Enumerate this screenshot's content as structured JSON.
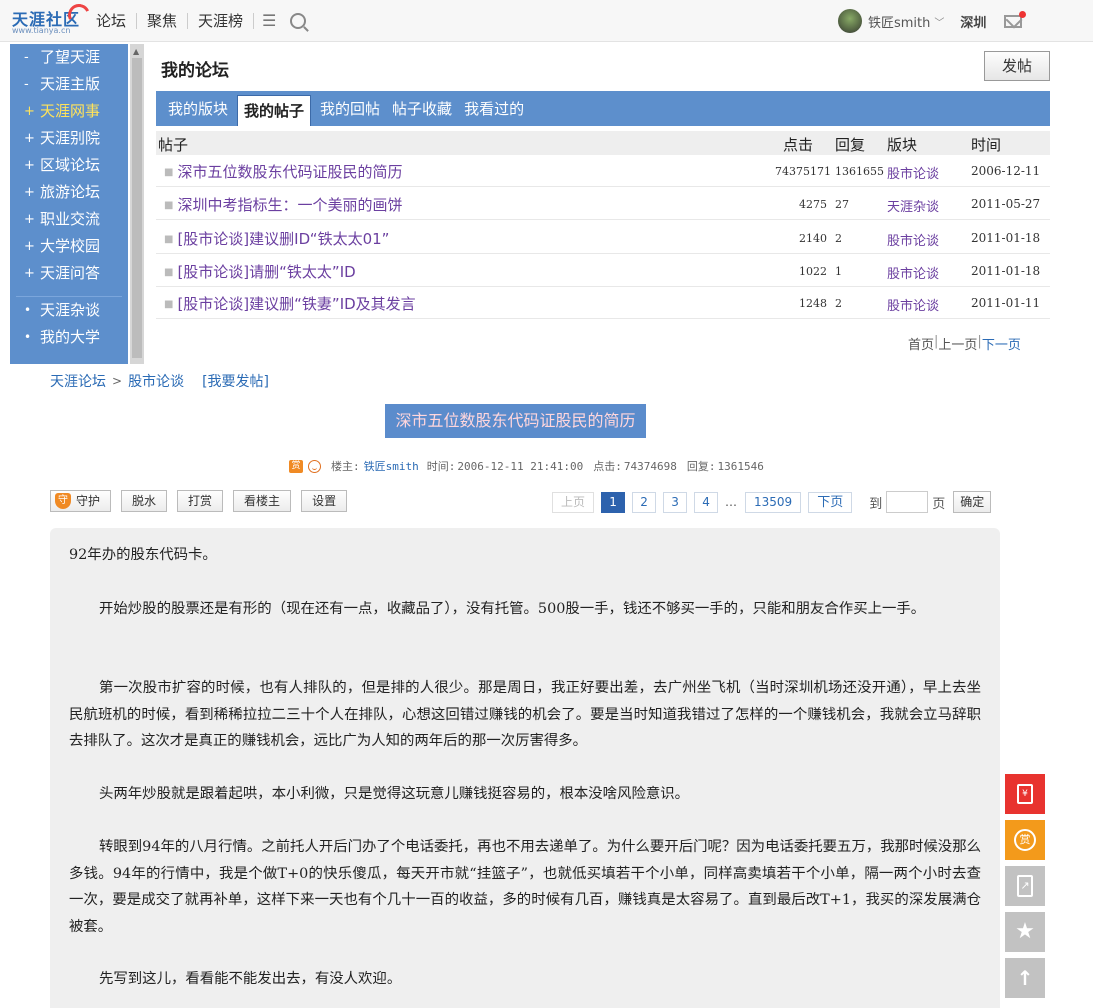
{
  "header": {
    "logo_main": "天涯社区",
    "logo_sub": "www.tianya.cn",
    "nav": [
      "论坛",
      "聚焦",
      "天涯榜"
    ],
    "username": "铁匠smith",
    "city": "深圳"
  },
  "sidebar": {
    "items": [
      {
        "sym": "-",
        "label": "了望天涯"
      },
      {
        "sym": "-",
        "label": "天涯主版"
      },
      {
        "sym": "+",
        "label": "天涯网事"
      },
      {
        "sym": "+",
        "label": "天涯别院"
      },
      {
        "sym": "+",
        "label": "区域论坛"
      },
      {
        "sym": "+",
        "label": "旅游论坛"
      },
      {
        "sym": "+",
        "label": "职业交流"
      },
      {
        "sym": "+",
        "label": "大学校园"
      },
      {
        "sym": "+",
        "label": "天涯问答"
      }
    ],
    "items2": [
      {
        "sym": "•",
        "label": "天涯杂谈"
      },
      {
        "sym": "•",
        "label": "我的大学"
      }
    ]
  },
  "forum": {
    "title": "我的论坛",
    "post_button": "发帖",
    "tabs": [
      "我的版块",
      "我的帖子",
      "我的回帖",
      "帖子收藏",
      "我看过的"
    ],
    "columns": {
      "topic": "帖子",
      "clicks": "点击",
      "replies": "回复",
      "board": "版块",
      "time": "时间"
    },
    "rows": [
      {
        "title": "深市五位数股东代码证股民的简历",
        "clicks": "74375171",
        "replies": "1361655",
        "board": "股市论谈",
        "date": "2006-12-11"
      },
      {
        "title": "深圳中考指标生：一个美丽的画饼",
        "clicks": "4275",
        "replies": "27",
        "board": "天涯杂谈",
        "date": "2011-05-27"
      },
      {
        "title": "[股市论谈]建议删ID“铁太太01”",
        "clicks": "2140",
        "replies": "2",
        "board": "股市论谈",
        "date": "2011-01-18"
      },
      {
        "title": "[股市论谈]请删“铁太太”ID",
        "clicks": "1022",
        "replies": "1",
        "board": "股市论谈",
        "date": "2011-01-18"
      },
      {
        "title": "[股市论谈]建议删“铁妻”ID及其发言",
        "clicks": "1248",
        "replies": "2",
        "board": "股市论谈",
        "date": "2011-01-11"
      }
    ],
    "pager": {
      "first": "首页",
      "prev": "上一页",
      "next": "下一页"
    }
  },
  "breadcrumb": {
    "home": "天涯论坛",
    "board": "股市论谈",
    "post": "[我要发帖]"
  },
  "thread": {
    "title": "深市五位数股东代码证股民的简历",
    "meta": {
      "owner_label": "楼主:",
      "owner": "铁匠smith",
      "time_label": "时间:",
      "time": "2006-12-11 21:41:00",
      "clicks_label": "点击:",
      "clicks": "74374698",
      "replies_label": "回复:",
      "replies": "1361546"
    },
    "actions": [
      "守护",
      "脱水",
      "打赏",
      "看楼主",
      "设置"
    ],
    "pagination": {
      "prev": "上页",
      "pages": [
        "1",
        "2",
        "3",
        "4"
      ],
      "ellipsis": "…",
      "last": "13509",
      "next": "下页",
      "goto_label": "到",
      "goto_after": "页",
      "confirm": "确定"
    },
    "paragraphs": [
      "92年办的股东代码卡。",
      "开始炒股的股票还是有形的（现在还有一点，收藏品了），没有托管。500股一手，钱还不够买一手的，只能和朋友合作买上一手。",
      "第一次股市扩容的时候，也有人排队的，但是排的人很少。那是周日，我正好要出差，去广州坐飞机（当时深圳机场还没开通），早上去坐民航班机的时候，看到稀稀拉拉二三十个人在排队，心想这回错过赚钱的机会了。要是当时知道我错过了怎样的一个赚钱机会，我就会立马辞职去排队了。这次才是真正的赚钱机会，远比广为人知的两年后的那一次厉害得多。",
      "头两年炒股就是跟着起哄，本小利微，只是觉得这玩意儿赚钱挺容易的，根本没啥风险意识。",
      "转眼到94年的八月行情。之前托人开后门办了个电话委托，再也不用去递单了。为什么要开后门呢？因为电话委托要五万，我那时候没那么多钱。94年的行情中，我是个做T+0的快乐傻瓜，每天开市就“挂篮子”，也就低买填若干个小单，同样高卖填若干个小单，隔一两个小时去查一次，要是成交了就再补单，这样下来一天也有个几十一百的收益，多的时候有几百，赚钱真是太容易了。直到最后改T+1，我买的深发展满仓被套。",
      "先写到这儿，看看能不能发出去，有没人欢迎。"
    ]
  },
  "floatbar": {
    "redpacket": "¥",
    "reward": "赏",
    "share": "↗",
    "favorite": "★",
    "top": "↑"
  },
  "colors": {
    "accent_blue": "#5d8fcc",
    "link_purple": "#6b3fa0",
    "red": "#e8332f",
    "orange": "#f39a1b"
  }
}
